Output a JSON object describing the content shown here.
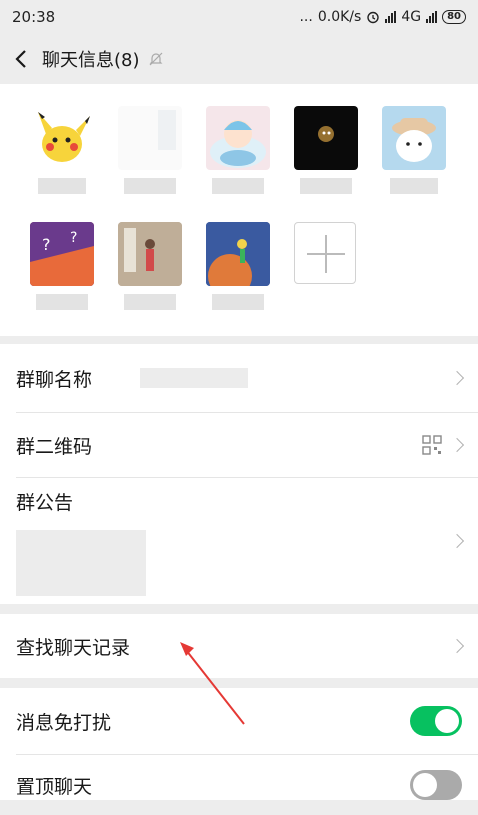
{
  "status_bar": {
    "time": "20:38",
    "dots": "...",
    "speed": "0.0K/s",
    "net_label": "4G",
    "battery": "80"
  },
  "header": {
    "title": "聊天信息(8)",
    "icons": [
      "back-icon",
      "mute-bell-icon"
    ]
  },
  "members": {
    "avatars": [
      "pikachu",
      "blank",
      "baby-with-hat",
      "dark-hands",
      "hat-bun",
      "question-marks",
      "person-photo",
      "planet-kid"
    ],
    "add_icon": "plus-icon"
  },
  "settings": {
    "group_name_label": "群聊名称",
    "qr_code_label": "群二维码",
    "announcement_label": "群公告",
    "search_history_label": "查找聊天记录",
    "mute_label": "消息免打扰",
    "mute_enabled": true,
    "pin_label": "置顶聊天",
    "pin_enabled": false
  },
  "colors": {
    "accent": "#07c160",
    "annotation_arrow": "#e53935"
  }
}
